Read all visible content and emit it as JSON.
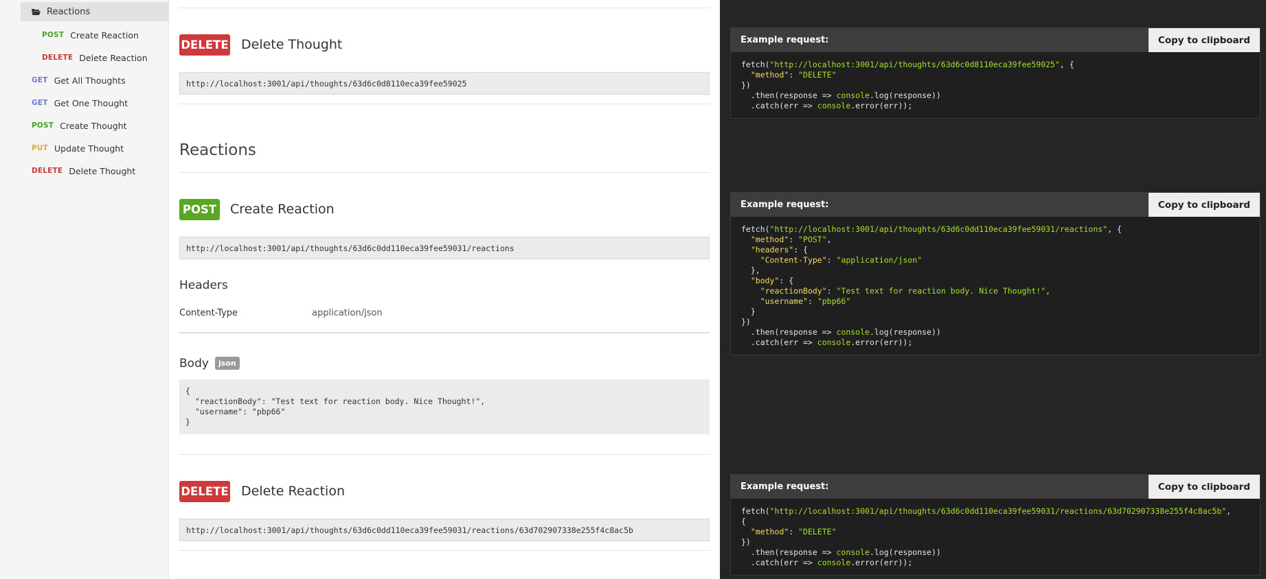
{
  "sidebar": {
    "folder": "Reactions",
    "items": [
      {
        "method": "POST",
        "label": "Create Reaction"
      },
      {
        "method": "DELETE",
        "label": "Delete Reaction"
      },
      {
        "method": "GET",
        "label": "Get All Thoughts"
      },
      {
        "method": "GET",
        "label": "Get One Thought"
      },
      {
        "method": "POST",
        "label": "Create Thought"
      },
      {
        "method": "PUT",
        "label": "Update Thought"
      },
      {
        "method": "DELETE",
        "label": "Delete Thought"
      }
    ]
  },
  "main": {
    "delete_thought": {
      "method": "DELETE",
      "title": "Delete Thought",
      "url": "http://localhost:3001/api/thoughts/63d6c0d8110eca39fee59025"
    },
    "section_title": "Reactions",
    "create_reaction": {
      "method": "POST",
      "title": "Create Reaction",
      "url": "http://localhost:3001/api/thoughts/63d6c0dd110eca39fee59031/reactions",
      "headers_title": "Headers",
      "header_key": "Content-Type",
      "header_value": "application/json",
      "body_title": "Body",
      "body_badge": "json",
      "body_json": "{\n  \"reactionBody\": \"Test text for reaction body. Nice Thought!\",\n  \"username\": \"pbp66\"\n}"
    },
    "delete_reaction": {
      "method": "DELETE",
      "title": "Delete Reaction",
      "url": "http://localhost:3001/api/thoughts/63d6c0dd110eca39fee59031/reactions/63d702907338e255f4c8ac5b"
    }
  },
  "examples": {
    "label": "Example request:",
    "copy_label": "Copy to clipboard",
    "ex1": {
      "url": "\"http://localhost:3001/api/thoughts/63d6c0d8110eca39fee59025\"",
      "method_key": "\"method\"",
      "method_val": "\"DELETE\""
    },
    "ex2": {
      "url": "\"http://localhost:3001/api/thoughts/63d6c0dd110eca39fee59031/reactions\"",
      "method_key": "\"method\"",
      "method_val": "\"POST\"",
      "headers_key": "\"headers\"",
      "ct_key": "\"Content-Type\"",
      "ct_val": "\"application/json\"",
      "body_key": "\"body\"",
      "rb_key": "\"reactionBody\"",
      "rb_val": "\"Test text for reaction body. Nice Thought!\"",
      "un_key": "\"username\"",
      "un_val": "\"pbp66\""
    },
    "ex3": {
      "url": "\"http://localhost:3001/api/thoughts/63d6c0dd110eca39fee59031/reactions/63d702907338e255f4c8ac5b\"",
      "method_key": "\"method\"",
      "method_val": "\"DELETE\""
    },
    "code": {
      "fetch": "fetch(",
      "then": "  .then(response => ",
      "console": "console",
      "log": ".log(response))",
      "catch": "  .catch(err => ",
      "error": ".error(err));"
    }
  },
  "colors": {
    "post": "#5aa522",
    "delete": "#d0393b",
    "get": "#6c7bd0",
    "put": "#e8a33a",
    "code_string": "#a6e22e",
    "code_key": "#f5dc62"
  }
}
